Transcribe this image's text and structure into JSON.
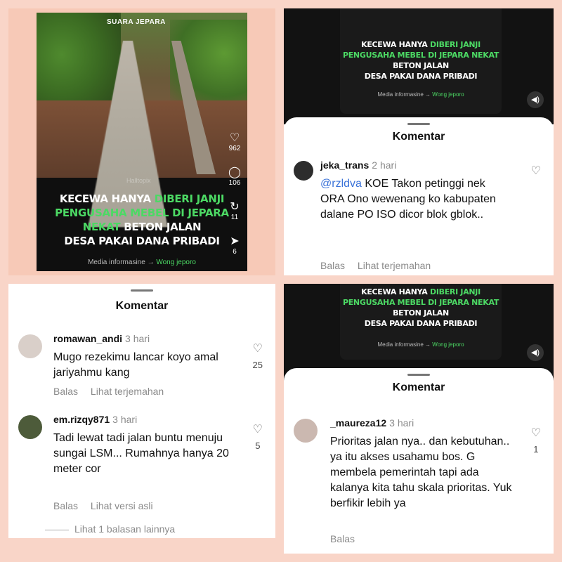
{
  "video": {
    "watermark": "SUARA JEPARA",
    "faint_watermark": "Halltopix",
    "headline_pre": "Kecewa hanya",
    "headline_green1": "diberi janji pengusaha mebel di Jepara nekat",
    "headline_post1": "beton jalan",
    "headline_line3": "desa pakai dana pribadi",
    "footer_text": "Media informasine →",
    "footer_brand": "Wong jeporo",
    "likes": "962",
    "comments": "106",
    "reposts": "11",
    "shares": "6"
  },
  "panel2": {
    "title": "Komentar",
    "comment": {
      "user": "jeka_trans",
      "time": "2 hari",
      "mention": "@rzldva",
      "text": " KOE Takon petinggi nek ORA Ono wewenang ko kabupaten dalane PO ISO dicor blok gblok..",
      "reply": "Balas",
      "translate": "Lihat terjemahan"
    }
  },
  "panel3": {
    "title": "Komentar",
    "comments": [
      {
        "user": "romawan_andi",
        "time": "3 hari",
        "text": "Mugo rezekimu lancar koyo amal jariyahmu kang",
        "reply": "Balas",
        "translate": "Lihat terjemahan",
        "likes": "25"
      },
      {
        "user": "em.rizqy871",
        "time": "3 hari",
        "text": "Tadi lewat tadi jalan buntu menuju sungai LSM... Rumahnya hanya 20 meter cor",
        "reply": "Balas",
        "translate": "Lihat versi asli",
        "likes": "5"
      }
    ],
    "more_replies": "Lihat 1 balasan lainnya"
  },
  "panel4": {
    "title": "Komentar",
    "comment": {
      "user": "_maureza12",
      "time": "3 hari",
      "text": "Prioritas jalan nya.. dan kebutuhan.. ya itu akses usahamu bos. G membela pemerintah tapi ada kalanya kita tahu skala prioritas. Yuk berfikir lebih ya",
      "reply": "Balas",
      "likes": "1"
    }
  }
}
